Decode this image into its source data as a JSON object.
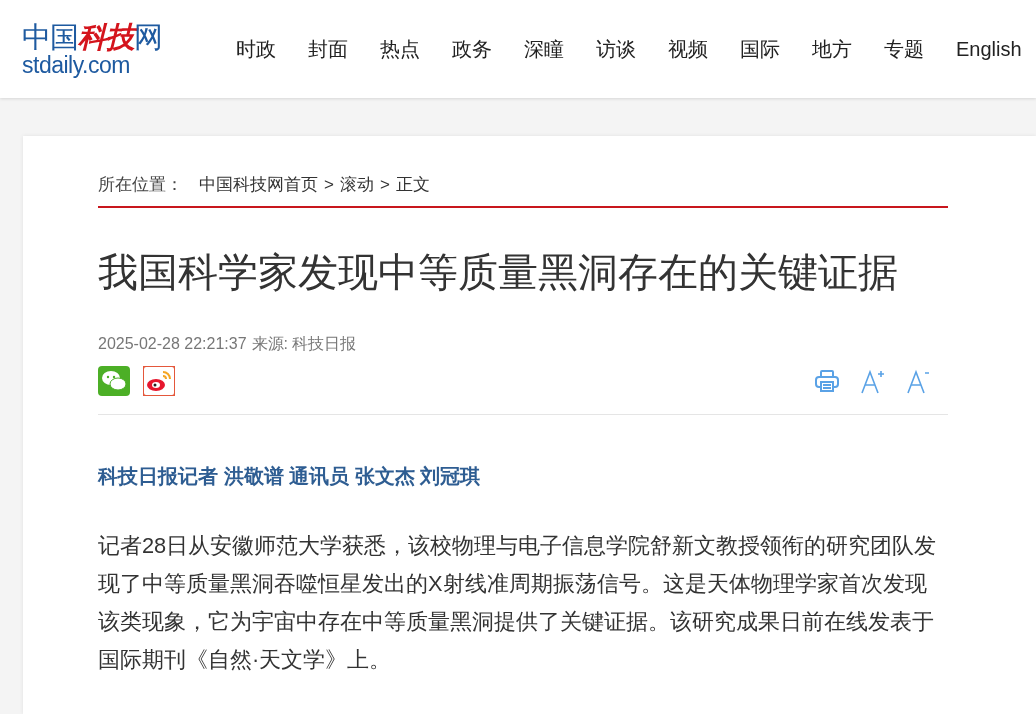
{
  "logo": {
    "prefix": "中国",
    "highlight": "科技",
    "suffix": "网",
    "domain": "stdaily.com"
  },
  "nav": [
    "时政",
    "封面",
    "热点",
    "政务",
    "深瞳",
    "访谈",
    "视频",
    "国际",
    "地方",
    "专题",
    "English"
  ],
  "breadcrumb": {
    "label": "所在位置：",
    "items": [
      "中国科技网首页",
      "滚动",
      "正文"
    ],
    "separator": ">"
  },
  "article": {
    "title": "我国科学家发现中等质量黑洞存在的关键证据",
    "datetime": "2025-02-28 22:21:37",
    "source": "来源: 科技日报",
    "byline": "科技日报记者 洪敬谱 通讯员 张文杰 刘冠琪",
    "paragraphs": [
      "记者28日从安徽师范大学获悉，该校物理与电子信息学院舒新文教授领衔的研究团队发现了中等质量黑洞吞噬恒星发出的X射线准周期振荡信号。这是天体物理学家首次发现该类现象，它为宇宙中存在中等质量黑洞提供了关键证据。该研究成果日前在线发表于国际期刊《自然·天文学》上。"
    ]
  }
}
